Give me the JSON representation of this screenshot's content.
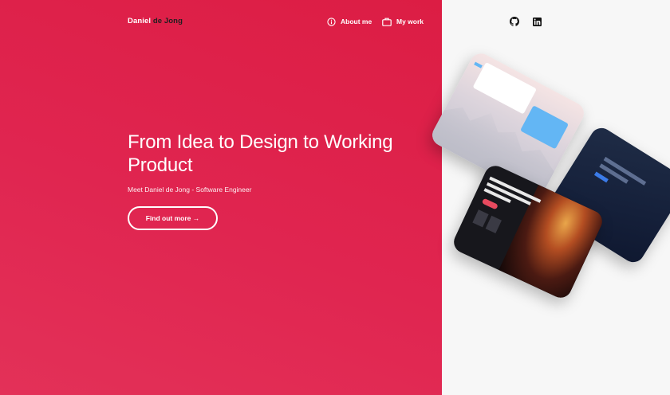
{
  "brand": {
    "first": "Daniel",
    "last": " de Jong"
  },
  "nav": {
    "about": {
      "label": "About me",
      "icon": "info-circle-icon"
    },
    "work": {
      "label": "My work",
      "icon": "briefcase-icon"
    }
  },
  "social": [
    {
      "name": "github",
      "icon": "github-icon"
    },
    {
      "name": "linkedin",
      "icon": "linkedin-icon"
    }
  ],
  "hero": {
    "title": "From Idea to Design to Working Product",
    "subtitle": "Meet Daniel de Jong - Software Engineer",
    "cta_label": "Find out more →"
  },
  "colors": {
    "accent": "#e0244d",
    "panel": "#f7f7f7",
    "text_light": "#ffffff",
    "text_dark": "#1f1f1f"
  }
}
